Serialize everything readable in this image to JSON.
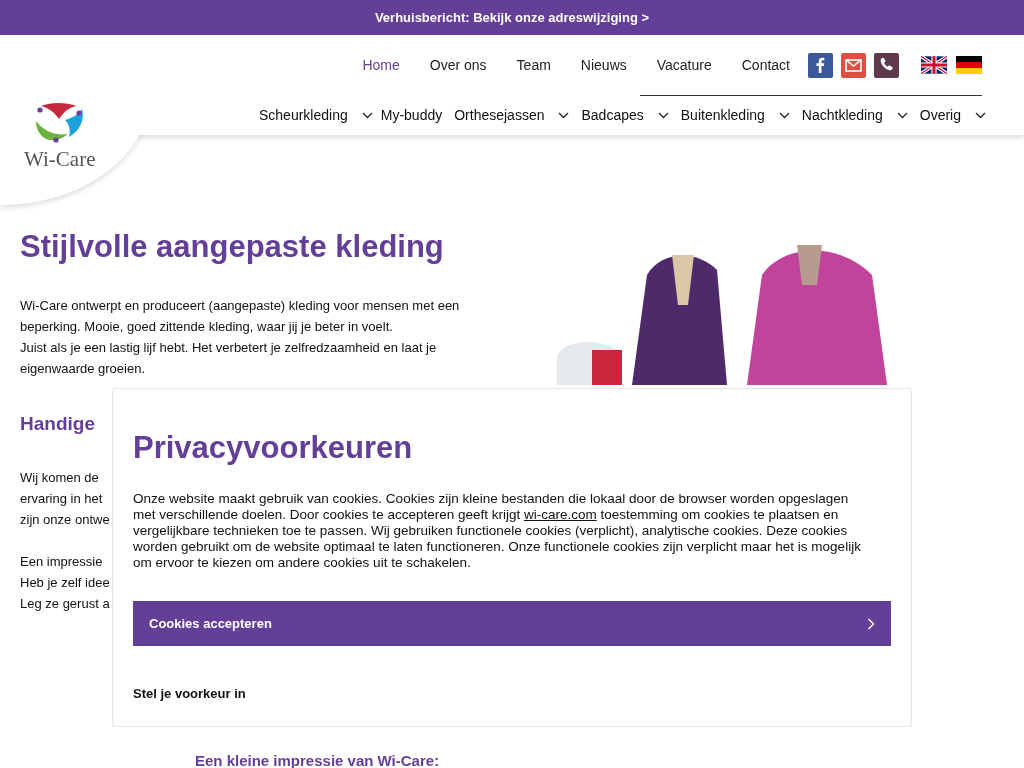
{
  "announcement": {
    "text": "Verhuisbericht: Bekijk onze adreswijziging >"
  },
  "top_nav": [
    {
      "label": "Home",
      "selected": true
    },
    {
      "label": "Over ons",
      "selected": false
    },
    {
      "label": "Team",
      "selected": false
    },
    {
      "label": "Nieuws",
      "selected": false
    },
    {
      "label": "Vacature",
      "selected": false
    },
    {
      "label": "Contact",
      "selected": false
    }
  ],
  "social": [
    {
      "kind": "facebook",
      "color": "#3b5998"
    },
    {
      "kind": "mail",
      "color": "#dd5044"
    },
    {
      "kind": "phone",
      "color": "#5e3a4c"
    }
  ],
  "languages": [
    {
      "kind": "en"
    },
    {
      "kind": "de"
    }
  ],
  "logo": {
    "text": "Wi-Care"
  },
  "main_nav": [
    {
      "label": "Scheurkleding",
      "dropdown": true
    },
    {
      "label": "My-buddy",
      "dropdown": false
    },
    {
      "label": "Orthesejassen",
      "dropdown": true
    },
    {
      "label": "Badcapes",
      "dropdown": true
    },
    {
      "label": "Buitenkleding",
      "dropdown": true
    },
    {
      "label": "Nachtkleding",
      "dropdown": true
    },
    {
      "label": "Overig",
      "dropdown": true
    }
  ],
  "content": {
    "title": "Stijlvolle aangepaste kleding",
    "intro": [
      "Wi-Care ontwerpt en produceert (aangepaste) kleding voor mensen met een beperking. Mooie, goed zittende kleding, waar jij je beter in voelt.",
      "Juist als je een lastig lijf hebt. Het verbetert je zelfredzaamheid en laat je eigenwaarde groeien."
    ],
    "subtitle": "Handige",
    "lines_1": [
      "Wij komen de",
      "ervaring in het",
      "zijn onze ontwe"
    ],
    "lines_2": [
      "Een impressie",
      "Heb je zelf idee",
      "Leg ze gerust a"
    ],
    "gallery_title": "Een kleine impressie van Wi-Care:"
  },
  "privacy": {
    "title": "Privacyvoorkeuren",
    "text_before": "Onze website maakt gebruik van cookies. Cookies zijn kleine bestanden die lokaal door de browser worden opgeslagen met verschillende doelen. Door cookies te accepteren geeft krijgt ",
    "link": "wi-care.com",
    "text_after": " toestemming om cookies te plaatsen en vergelijkbare technieken toe te passen. Wij gebruiken functionele cookies (verplicht), analytische cookies. Deze cookies worden gebruikt om de website optimaal te laten functioneren. Onze functionele cookies zijn verplicht maar het is mogelijk om ervoor te kiezen om andere cookies uit te schakelen.",
    "accept": "Cookies accepteren",
    "preferences": "Stel je voorkeur in"
  }
}
